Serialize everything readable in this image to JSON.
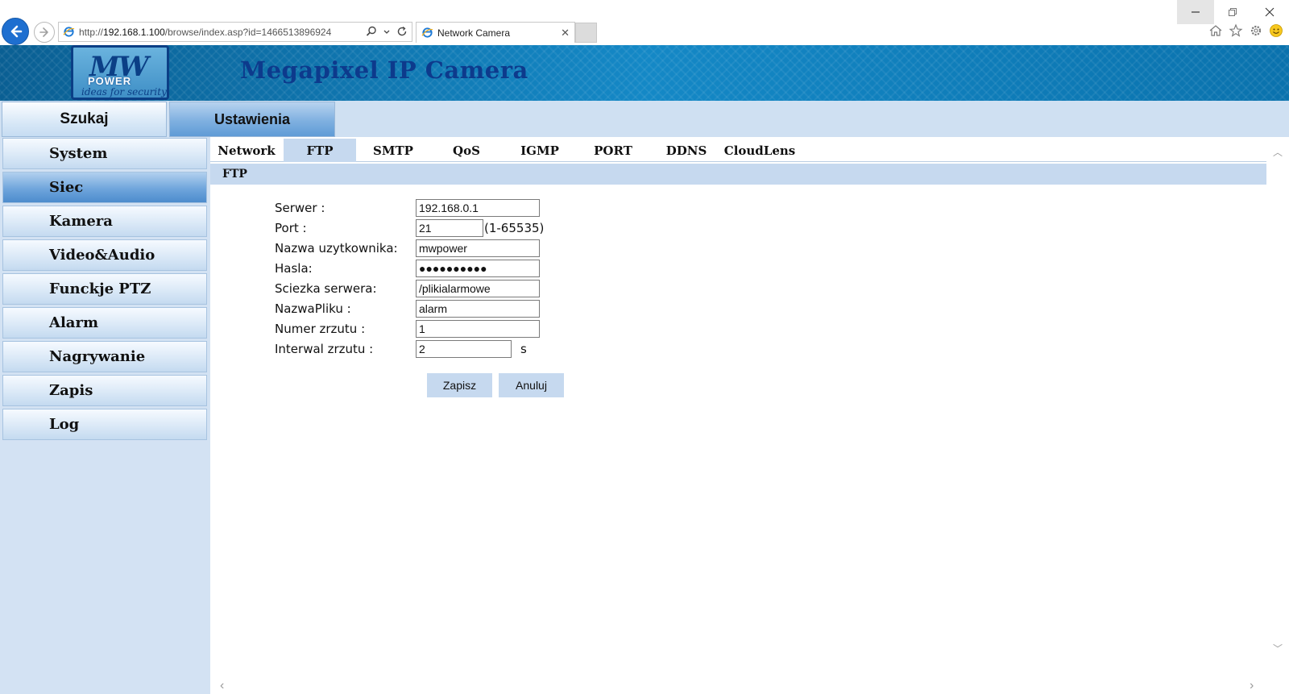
{
  "browser": {
    "url_prefix": "http://",
    "url_host": "192.168.1.100",
    "url_path": "/browse/index.asp?id=1466513896924",
    "tab_title": "Network Camera"
  },
  "banner": {
    "logo_mw": "MW",
    "logo_power": "POWER",
    "logo_tagline": "ideas for security",
    "title": "Megapixel IP Camera"
  },
  "topmenu": {
    "search": "Szukaj",
    "settings": "Ustawienia"
  },
  "sidebar": {
    "items": [
      {
        "label": "System"
      },
      {
        "label": "Siec"
      },
      {
        "label": "Kamera"
      },
      {
        "label": "Video&Audio"
      },
      {
        "label": "Funckje PTZ"
      },
      {
        "label": "Alarm"
      },
      {
        "label": "Nagrywanie"
      },
      {
        "label": "Zapis"
      },
      {
        "label": "Log"
      }
    ],
    "active": "Siec"
  },
  "subtabs": {
    "items": [
      "Network",
      "FTP",
      "SMTP",
      "QoS",
      "IGMP",
      "PORT",
      "DDNS",
      "CloudLens"
    ],
    "active": "FTP"
  },
  "section": {
    "title": "FTP"
  },
  "form": {
    "server_label": "Serwer :",
    "server_value": "192.168.0.1",
    "port_label": "Port :",
    "port_value": "21",
    "port_range": "(1-65535)",
    "username_label": "Nazwa uzytkownika:",
    "username_value": "mwpower",
    "password_label": "Hasla:",
    "password_value": "●●●●●●●●●●",
    "path_label": "Sciezka serwera:",
    "path_value": "/plikialarmowe",
    "filename_label": "NazwaPliku :",
    "filename_value": "alarm",
    "snapshot_count_label": "Numer zrzutu :",
    "snapshot_count_value": "1",
    "snapshot_interval_label": "Interwal zrzutu :",
    "snapshot_interval_value": "2",
    "snapshot_interval_unit": "s",
    "save_label": "Zapisz",
    "cancel_label": "Anuluj"
  }
}
